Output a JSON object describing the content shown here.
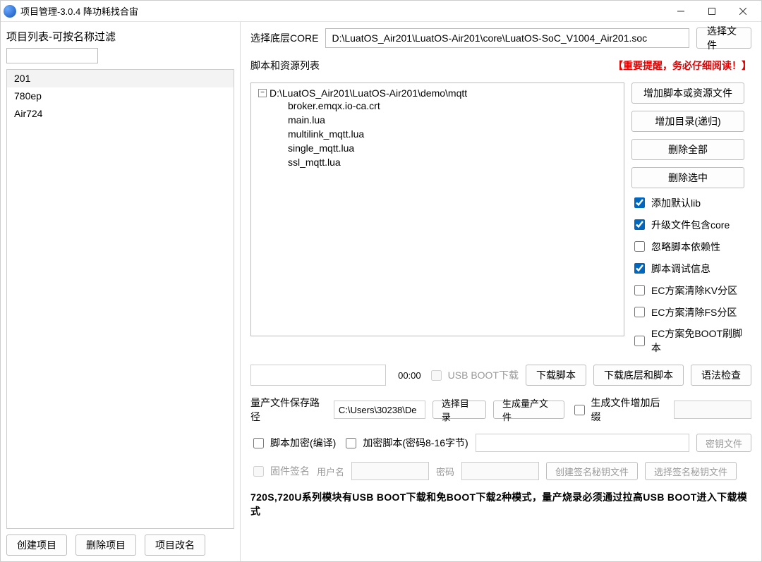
{
  "titlebar": {
    "title": "项目管理-3.0.4 降功耗找合宙"
  },
  "sidebar": {
    "header": "项目列表-可按名称过滤",
    "filter_value": "",
    "projects": [
      "201",
      "780ep",
      "Air724"
    ],
    "selected_index": 0,
    "buttons": {
      "create": "创建项目",
      "delete": "删除项目",
      "rename": "项目改名"
    }
  },
  "core": {
    "label": "选择底层CORE",
    "path": "D:\\LuatOS_Air201\\LuatOS-Air201\\core\\LuatOS-SoC_V1004_Air201.soc",
    "choose_btn": "选择文件"
  },
  "scripts": {
    "header": "脚本和资源列表",
    "warning": "【重要提醒，务必仔细阅读！】",
    "tree": {
      "root": "D:\\LuatOS_Air201\\LuatOS-Air201\\demo\\mqtt",
      "files": [
        "broker.emqx.io-ca.crt",
        "main.lua",
        "multilink_mqtt.lua",
        "single_mqtt.lua",
        "ssl_mqtt.lua"
      ]
    },
    "actions": {
      "add_file": "增加脚本或资源文件",
      "add_dir": "增加目录(递归)",
      "delete_all": "删除全部",
      "delete_selected": "删除选中"
    },
    "checks": {
      "add_lib": {
        "label": "添加默认lib",
        "checked": true
      },
      "upgrade_core": {
        "label": "升级文件包含core",
        "checked": true
      },
      "ignore_deps": {
        "label": "忽略脚本依赖性",
        "checked": false
      },
      "debug_info": {
        "label": "脚本调试信息",
        "checked": true
      },
      "ec_clear_kv": {
        "label": "EC方案清除KV分区",
        "checked": false
      },
      "ec_clear_fs": {
        "label": "EC方案清除FS分区",
        "checked": false
      },
      "ec_noboot": {
        "label": "EC方案免BOOT刷脚本",
        "checked": false
      }
    }
  },
  "download": {
    "time": "00:00",
    "usb_boot_label": "USB BOOT下载",
    "usb_boot_checked": false,
    "download_script": "下载脚本",
    "download_core_script": "下载底层和脚本",
    "syntax_check": "语法检查"
  },
  "mass": {
    "label": "量产文件保存路径",
    "path": "C:\\Users\\30238\\De",
    "choose_dir": "选择目录",
    "gen_file": "生成量产文件",
    "suffix_label": "生成文件增加后缀",
    "suffix_checked": false,
    "suffix_value": ""
  },
  "encrypt": {
    "compile_label": "脚本加密(编译)",
    "compile_checked": false,
    "pwd_label": "加密脚本(密码8-16字节)",
    "pwd_checked": false,
    "pwd_value": "",
    "key_file_btn": "密钥文件"
  },
  "sign": {
    "fw_sign_label": "固件签名",
    "fw_sign_checked": false,
    "user_label": "用户名",
    "user_value": "",
    "pwd_label": "密码",
    "pwd_value": "",
    "create_key": "创建签名秘钥文件",
    "choose_key": "选择签名秘钥文件"
  },
  "footer_note": "720S,720U系列模块有USB BOOT下载和免BOOT下载2种模式，量产烧录必须通过拉高USB BOOT进入下载模式"
}
